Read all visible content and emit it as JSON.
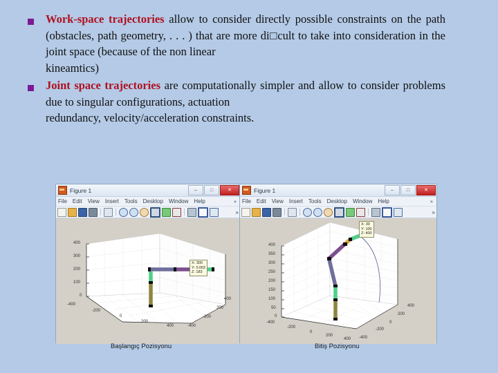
{
  "slide": {
    "background_color": "#b4cae6",
    "bullets": [
      {
        "marker": "square-bullet",
        "keyword": "Work-space trajectories",
        "keyword_color": "#b01020",
        "text_part1": " allow to consider directly possible constraints on the path (obstacles, path geometry, . . . ) that are more di□cult to take into consideration in the joint space (because of the non linear",
        "text_part2": "kineamtics)"
      },
      {
        "marker": "square-bullet",
        "keyword": "Joint space trajectories",
        "keyword_color": "#b01020",
        "text_part1": " are computationally simpler and allow to consider problems due to singular configurations, actuation",
        "text_part2": "redundancy, velocity/acceleration constraints."
      }
    ]
  },
  "figures": [
    {
      "id": "fig-left",
      "title": "Figure 1",
      "window_buttons": {
        "minimize": "–",
        "maximize": "□",
        "close": "✕"
      },
      "menus": [
        "File",
        "Edit",
        "View",
        "Insert",
        "Tools",
        "Desktop",
        "Window",
        "Help"
      ],
      "menu_overflow": "»",
      "toolbar_overflow": "»",
      "toolbar_icons": [
        "new-figure-icon",
        "open-file-icon",
        "save-icon",
        "print-icon",
        "data-cursor-icon",
        "zoom-in-icon",
        "zoom-out-icon",
        "pan-icon",
        "rotate-3d-icon",
        "data-brush-icon",
        "insert-colorbar-icon",
        "link-plot-icon",
        "figure-palette-icon",
        "plot-browser-icon"
      ],
      "caption": "Başlangıç Pozisyonu",
      "chart_data": {
        "type": "scatter",
        "title": "",
        "xlabel": "",
        "ylabel": "",
        "zlabel": "",
        "xticks": [
          -400,
          -200,
          0,
          200,
          400
        ],
        "yticks": [
          -400,
          -200,
          0,
          200,
          400
        ],
        "zticks": [
          0,
          100,
          200,
          300,
          400
        ],
        "xlim": [
          -400,
          400
        ],
        "ylim": [
          -400,
          400
        ],
        "zlim": [
          0,
          400
        ],
        "grid": true,
        "datatip": {
          "x_label": "X:",
          "x": "300",
          "y_label": "Y:",
          "y": "0.002",
          "z_label": "Z:",
          "z": "183"
        },
        "annotation": "Robot manipulator shown in horizontal (home) pose"
      }
    },
    {
      "id": "fig-right",
      "title": "Figure 1",
      "window_buttons": {
        "minimize": "–",
        "maximize": "□",
        "close": "✕"
      },
      "menus": [
        "File",
        "Edit",
        "View",
        "Insert",
        "Tools",
        "Desktop",
        "Window",
        "Help"
      ],
      "menu_overflow": "»",
      "toolbar_overflow": "»",
      "toolbar_icons": [
        "new-figure-icon",
        "open-file-icon",
        "save-icon",
        "print-icon",
        "data-cursor-icon",
        "zoom-in-icon",
        "zoom-out-icon",
        "pan-icon",
        "rotate-3d-icon",
        "data-brush-icon",
        "insert-colorbar-icon",
        "link-plot-icon",
        "figure-palette-icon",
        "plot-browser-icon"
      ],
      "caption": "Bitiş Pozisyonu",
      "chart_data": {
        "type": "scatter",
        "title": "",
        "xlabel": "",
        "ylabel": "",
        "zlabel": "",
        "xticks": [
          -400,
          -200,
          0,
          200,
          400
        ],
        "yticks": [
          -400,
          -200,
          0,
          200,
          400
        ],
        "zticks": [
          0,
          50,
          100,
          150,
          200,
          250,
          300,
          350,
          400
        ],
        "xlim": [
          -400,
          400
        ],
        "ylim": [
          -400,
          400
        ],
        "zlim": [
          0,
          400
        ],
        "grid": true,
        "datatip": {
          "x_label": "X:",
          "x": "30",
          "y_label": "Y:",
          "y": "100",
          "z_label": "Z:",
          "z": "400"
        },
        "annotation": "Robot manipulator shown in raised pose with end-effector trajectory arc"
      }
    }
  ]
}
